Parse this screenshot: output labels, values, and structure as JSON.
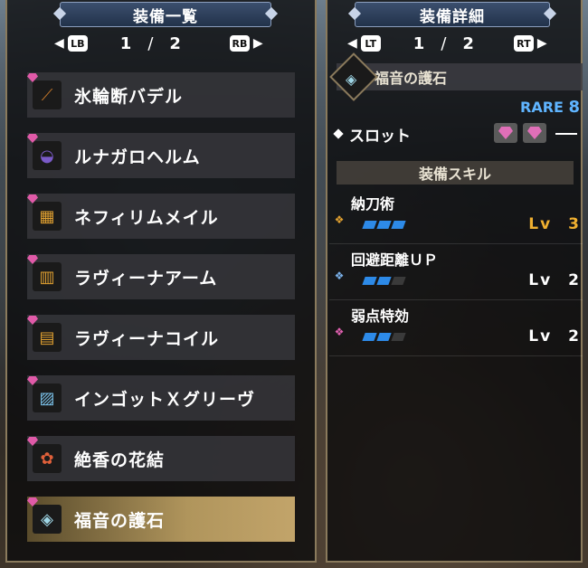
{
  "left_panel": {
    "title": "装備一覧",
    "page_current": "1",
    "page_sep": "/",
    "page_total": "2",
    "prev_button": "LB",
    "next_button": "RB",
    "items": [
      {
        "name": "氷輪断バデル",
        "icon": "great-sword-icon",
        "color": "#c97a2a",
        "glyph": "⟋",
        "selected": false
      },
      {
        "name": "ルナガロヘルム",
        "icon": "helm-icon",
        "color": "#7a5ac8",
        "glyph": "◒",
        "selected": false
      },
      {
        "name": "ネフィリムメイル",
        "icon": "chest-armor-icon",
        "color": "#e0a030",
        "glyph": "▦",
        "selected": false
      },
      {
        "name": "ラヴィーナアーム",
        "icon": "arm-armor-icon",
        "color": "#e0a030",
        "glyph": "▥",
        "selected": false
      },
      {
        "name": "ラヴィーナコイル",
        "icon": "waist-armor-icon",
        "color": "#e0a030",
        "glyph": "▤",
        "selected": false
      },
      {
        "name": "インゴットＸグリーヴ",
        "icon": "leg-armor-icon",
        "color": "#7ac0e8",
        "glyph": "▨",
        "selected": false
      },
      {
        "name": "絶香の花結",
        "icon": "flower-icon",
        "color": "#e0603a",
        "glyph": "✿",
        "selected": false
      },
      {
        "name": "福音の護石",
        "icon": "charm-icon",
        "color": "#9fd6e6",
        "glyph": "◈",
        "selected": true
      }
    ]
  },
  "right_panel": {
    "title": "装備詳細",
    "page_current": "1",
    "page_sep": "/",
    "page_total": "2",
    "prev_button": "LT",
    "next_button": "RT",
    "item_name": "福音の護石",
    "rarity_label": "RARE",
    "rarity_value": "8",
    "slot_label": "スロット",
    "skill_header": "装備スキル",
    "skills": [
      {
        "name": "納刀術",
        "level_label": "Lv",
        "level": "3",
        "max": 3,
        "filled": 3,
        "icon_color": "#e0a030",
        "level_color": "#f0b030"
      },
      {
        "name": "回避距離ＵＰ",
        "level_label": "Lv",
        "level": "2",
        "max": 3,
        "filled": 2,
        "icon_color": "#7ab0e8",
        "level_color": "#ffffff"
      },
      {
        "name": "弱点特効",
        "level_label": "Lv",
        "level": "2",
        "max": 3,
        "filled": 2,
        "icon_color": "#e060b0",
        "level_color": "#ffffff"
      }
    ]
  },
  "colors": {
    "accent_blue": "#2d8ae8",
    "rare_blue": "#5fb4ff",
    "gem_pink": "#e05aa8",
    "level_gold": "#f0b030",
    "selected_gold": "#c2a46a"
  }
}
